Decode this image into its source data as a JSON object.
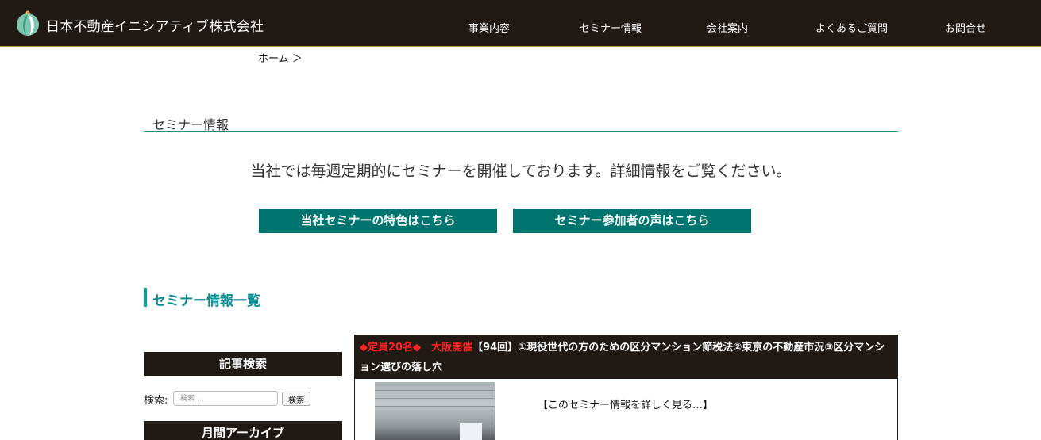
{
  "header": {
    "company_name": "日本不動産イニシアティブ株式会社",
    "nav": [
      "事業内容",
      "セミナー情報",
      "会社案内",
      "よくあるご質問",
      "お問合せ"
    ]
  },
  "breadcrumb": "ホーム ＞",
  "page": {
    "title": "セミナー情報",
    "intro": "当社では毎週定期的にセミナーを開催しております。詳細情報をご覧ください。",
    "buttons": [
      "当社セミナーの特色はこちら",
      "セミナー参加者の声はこちら"
    ],
    "list_heading": "セミナー情報一覧"
  },
  "sidebar": {
    "search_heading": "記事検索",
    "search_label": "検索:",
    "search_placeholder": "検索 …",
    "search_button": "検索",
    "archive_heading": "月間アーカイブ"
  },
  "post": {
    "badge": "◆定員20名◆　大阪開催",
    "title": "【94回】①現役世代の方のための区分マンション節税法②東京の不動産市況③区分マンション選びの落し穴",
    "read_more": "【このセミナー情報を詳しく見る…】"
  },
  "colors": {
    "header_bg": "#211914",
    "accent_teal": "#00756f",
    "heading_teal": "#0a8c93",
    "badge_red": "#ff2222"
  }
}
